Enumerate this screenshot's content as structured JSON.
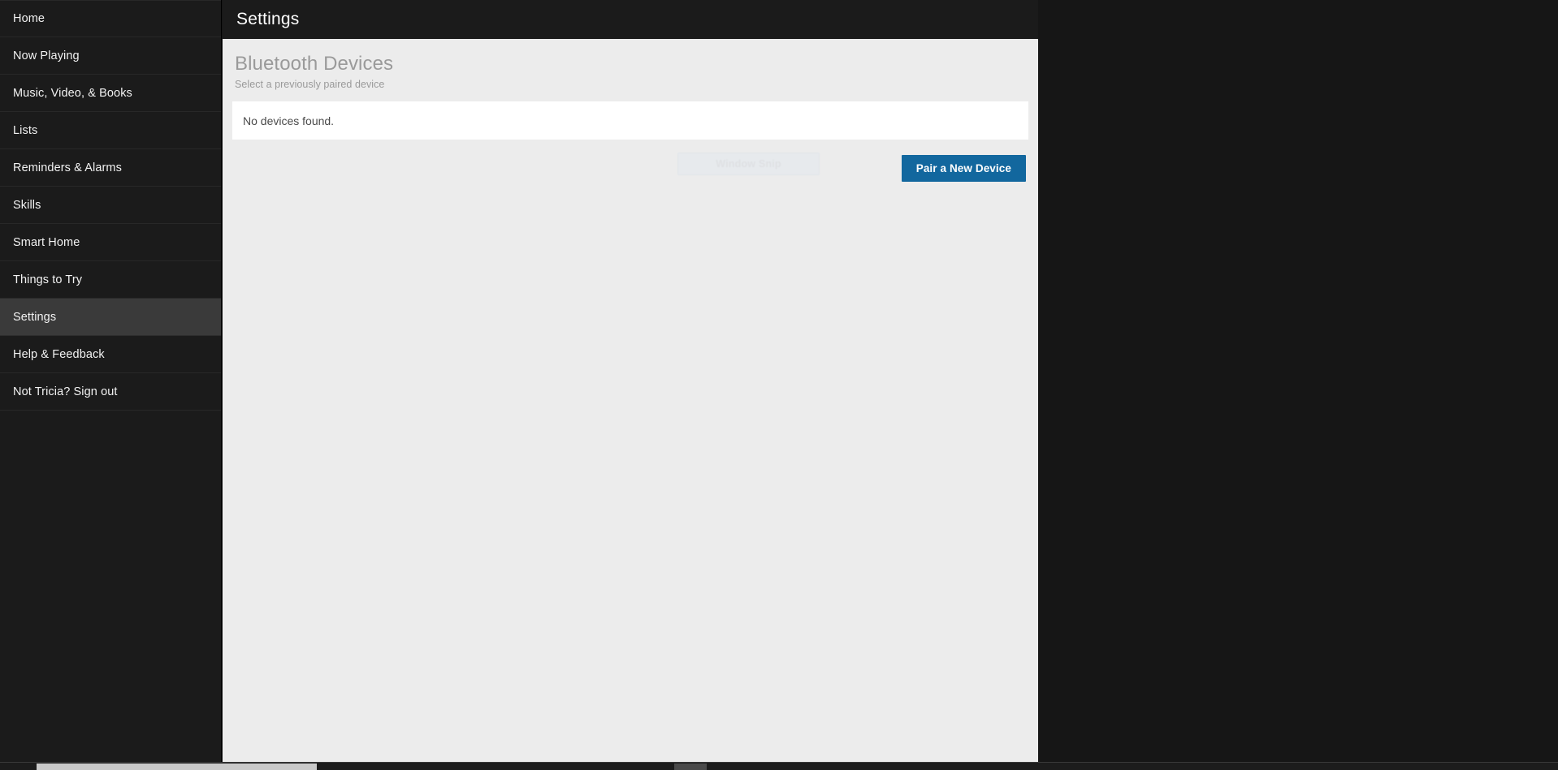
{
  "window": {
    "background_color": "#161616",
    "panel_background": "#ececec"
  },
  "sidebar": {
    "background_color": "#1b1b1b",
    "active_background": "#3a3a3a",
    "items": [
      {
        "label": "Home",
        "active": false
      },
      {
        "label": "Now Playing",
        "active": false
      },
      {
        "label": "Music, Video, & Books",
        "active": false
      },
      {
        "label": "Lists",
        "active": false
      },
      {
        "label": "Reminders & Alarms",
        "active": false
      },
      {
        "label": "Skills",
        "active": false
      },
      {
        "label": "Smart Home",
        "active": false
      },
      {
        "label": "Things to Try",
        "active": false
      },
      {
        "label": "Settings",
        "active": true
      },
      {
        "label": "Help & Feedback",
        "active": false
      },
      {
        "label": "Not Tricia? Sign out",
        "active": false
      }
    ]
  },
  "topbar": {
    "title": "Settings"
  },
  "section": {
    "title": "Bluetooth Devices",
    "subtitle": "Select a previously paired device",
    "title_color": "#9a9a9a"
  },
  "devices": {
    "empty_message": "No devices found.",
    "rows": []
  },
  "actions": {
    "ghost_label": "Window Snip",
    "primary_label": "Pair a New Device",
    "primary_color": "#12679e"
  },
  "scrollbar": {
    "orientation": "horizontal",
    "thumb_color": "#c9c9c9"
  }
}
